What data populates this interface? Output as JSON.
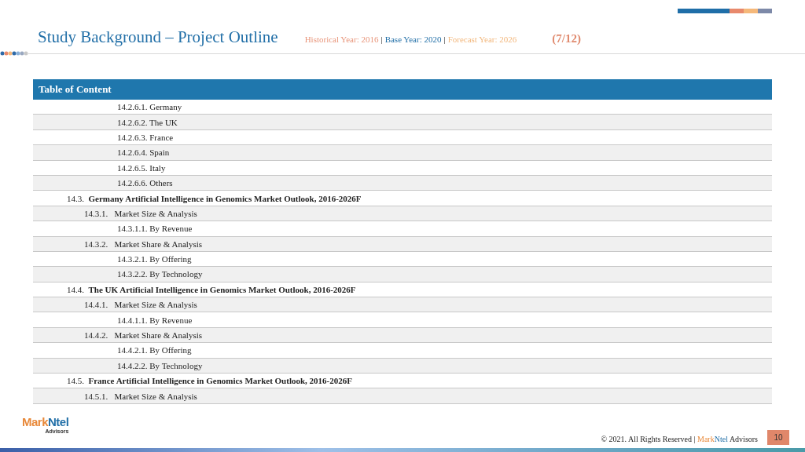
{
  "header": {
    "title": "Study Background – Project Outline",
    "historical": "Historical Year: 2016",
    "separator_1": "|",
    "base": "Base Year: 2020",
    "separator_2": "|",
    "forecast": "Forecast Year: 2026",
    "page_count": "(7/12)"
  },
  "toc": {
    "heading": "Table of Content",
    "continued": [
      {
        "text": "14.2.6.1. Germany"
      },
      {
        "text": "14.2.6.2. The UK"
      },
      {
        "text": "14.2.6.3. France"
      },
      {
        "text": "14.2.6.4. Spain"
      },
      {
        "text": "14.2.6.5. Italy"
      },
      {
        "text": "14.2.6.6. Others"
      }
    ],
    "sections": [
      {
        "text": "14.3.  **Germany Artificial Intelligence in Genomics Market Outlook, 2016-2026F**",
        "children": [
          {
            "text": "14.3.1.   Market Size & Analysis",
            "children": [
              {
                "text": "14.3.1.1. By Revenue"
              }
            ]
          },
          {
            "text": "14.3.2.   Market Share & Analysis",
            "children": [
              {
                "text": "14.3.2.1. By Offering"
              },
              {
                "text": "14.3.2.2. By Technology"
              }
            ]
          }
        ]
      },
      {
        "text": "14.4.  **The UK Artificial Intelligence in Genomics Market Outlook, 2016-2026F**",
        "children": [
          {
            "text": "14.4.1.   Market Size & Analysis",
            "children": [
              {
                "text": "14.4.1.1. By Revenue"
              }
            ]
          },
          {
            "text": "14.4.2.   Market Share & Analysis",
            "children": [
              {
                "text": "14.4.2.1. By Offering"
              },
              {
                "text": "14.4.2.2. By Technology"
              }
            ]
          }
        ]
      },
      {
        "text": "14.5.  **France Artificial Intelligence in Genomics Market Outlook, 2016-2026F**",
        "children": [
          {
            "text": "14.5.1.   Market Size & Analysis"
          }
        ]
      }
    ]
  },
  "footer": {
    "logo_mark": "Mark",
    "logo_ntel": "Ntel",
    "logo_sub": "Advisors",
    "copyright": "© 2021. All Rights Reserved |",
    "brand_mark": "Mark",
    "brand_ntel": "Ntel",
    "brand_rest": "Advisors",
    "page_number": "10"
  }
}
